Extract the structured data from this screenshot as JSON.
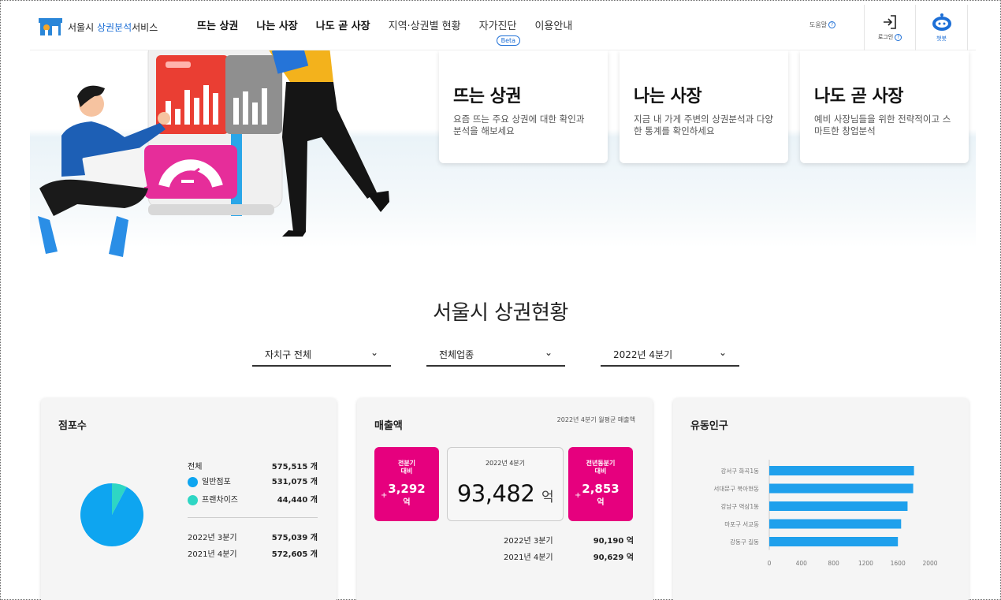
{
  "header": {
    "logo_text_1": "서울시",
    "logo_text_2": "상권분석",
    "logo_text_3": "서비스",
    "nav": [
      "뜨는 상권",
      "나는 사장",
      "나도 곧 사장",
      "지역·상권별 현황",
      "자가진단",
      "이용안내"
    ],
    "beta": "Beta",
    "help": "도움말",
    "login": "로그인",
    "chatbot": "챗봇"
  },
  "hero_cards": [
    {
      "title": "뜨는 상권",
      "desc": "요즘 뜨는 주요 상권에 대한 확인과 분석을 해보세요"
    },
    {
      "title": "나는 사장",
      "desc": "지금 내 가게 주변의 상권분석과 다양한 통계를 확인하세요"
    },
    {
      "title": "나도 곧 사장",
      "desc": "예비 사장님들을 위한 전략적이고 스마트한 창업분석"
    }
  ],
  "section_title": "서울시 상권현황",
  "filters": {
    "district": "자치구 전체",
    "industry": "전체업종",
    "quarter": "2022년 4분기"
  },
  "stores": {
    "title": "점포수",
    "total_label": "전체",
    "total_value": "575,515 개",
    "general_label": "일반점포",
    "general_value": "531,075 개",
    "franchise_label": "프랜차이즈",
    "franchise_value": "44,440 개",
    "prev_q_label": "2022년 3분기",
    "prev_q_value": "575,039 개",
    "prev_y_label": "2021년 4분기",
    "prev_y_value": "572,605 개",
    "general_count": 531075,
    "franchise_count": 44440,
    "general_color": "#0ea5f0",
    "franchise_color": "#2ed6c4"
  },
  "sales": {
    "title": "매출액",
    "subtitle": "2022년 4분기 월평균 매출액",
    "qoq_label_1": "전분기",
    "qoq_label_2": "대비",
    "qoq_sign": "+",
    "qoq_value": "3,292",
    "qoq_unit": "억",
    "center_label": "2022년 4분기",
    "center_value": "93,482",
    "center_unit": "억",
    "yoy_label_1": "전년동분기",
    "yoy_label_2": "대비",
    "yoy_sign": "+",
    "yoy_value": "2,853",
    "yoy_unit": "억",
    "prev_q_label": "2022년 3분기",
    "prev_q_value": "90,190 억",
    "prev_y_label": "2021년 4분기",
    "prev_y_value": "90,629 억",
    "accent": "#e6007e"
  },
  "population": {
    "title": "유동인구",
    "bar_color": "#1fa0ec"
  },
  "chart_data": {
    "type": "bar",
    "orientation": "horizontal",
    "categories": [
      "강서구 화곡1동",
      "서대문구 북아현동",
      "강남구 역삼1동",
      "마포구 서교동",
      "강동구 길동"
    ],
    "values": [
      1800,
      1790,
      1720,
      1640,
      1600
    ],
    "xticks": [
      "0",
      "400",
      "800",
      "1200",
      "1600",
      "2000"
    ],
    "xlim": [
      0,
      2000
    ],
    "title": "",
    "xlabel": "",
    "ylabel": ""
  }
}
